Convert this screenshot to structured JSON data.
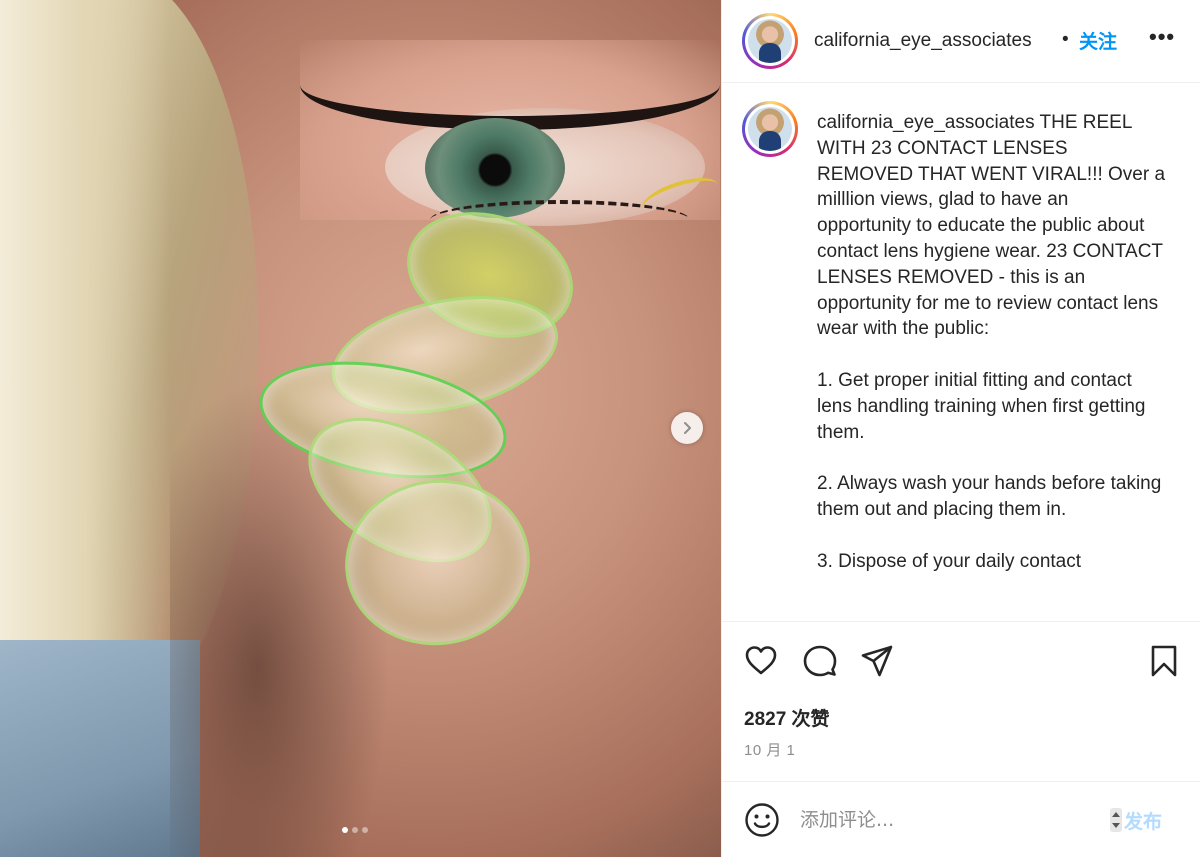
{
  "post": {
    "image_alt": "Close-up of an eye with a stack of contact lenses removed",
    "carousel": {
      "total": 3,
      "active_index": 0
    }
  },
  "header": {
    "username": "california_eye_associates",
    "separator": "•",
    "follow_label": "关注",
    "more_label": "•••"
  },
  "caption": {
    "username": "california_eye_associates",
    "text": " THE REEL WITH 23 CONTACT LENSES REMOVED THAT WENT VIRAL!!! Over a milllion views, glad to have an opportunity to educate the public about contact lens hygiene wear. 23 CONTACT LENSES REMOVED - this is an opportunity for me to review contact lens wear with the public:\n\n1. Get proper initial fitting and contact lens handling training when first getting them.\n\n2. Always wash your hands before taking them out and placing them in.\n\n3. Dispose of your daily contact"
  },
  "actions": {
    "icons": [
      "heart-icon",
      "comment-icon",
      "share-icon",
      "bookmark-icon"
    ],
    "likes": "2827 次赞",
    "date": "10 月 1"
  },
  "comment_bar": {
    "placeholder": "添加评论...",
    "post_label": "发布",
    "icon": "emoji-icon"
  },
  "colors": {
    "accent": "#0095f6",
    "post_disabled": "#b3dbff",
    "border": "#efefef",
    "muted_text": "#8e8e8e"
  }
}
